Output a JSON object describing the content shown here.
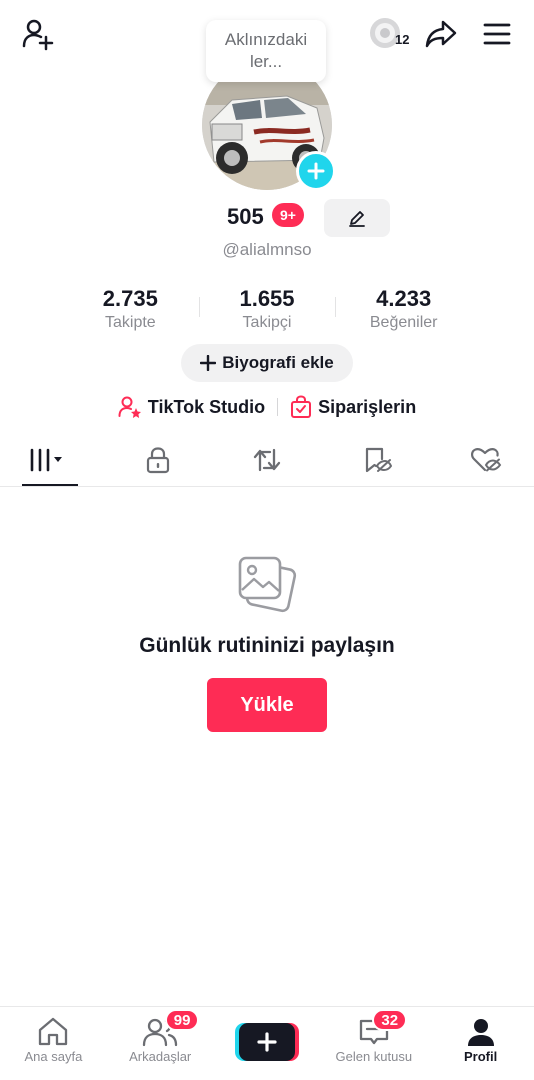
{
  "top_bar": {
    "coin_count": "12"
  },
  "bubble": {
    "text": "Aklınızdaki ler..."
  },
  "profile": {
    "count": "505",
    "badge": "9+",
    "handle": "@alialmnso"
  },
  "stats": [
    {
      "value": "2.735",
      "label": "Takipte"
    },
    {
      "value": "1.655",
      "label": "Takipçi"
    },
    {
      "value": "4.233",
      "label": "Beğeniler"
    }
  ],
  "bio_button": {
    "label": "Biyografi ekle"
  },
  "links": {
    "studio": "TikTok Studio",
    "orders": "Siparişlerin"
  },
  "empty_state": {
    "title": "Günlük rutininizi paylaşın",
    "button": "Yükle"
  },
  "bottom_nav": {
    "items": [
      {
        "label": "Ana sayfa",
        "icon": "home-icon"
      },
      {
        "label": "Arkadaşlar",
        "icon": "friends-icon",
        "badge": "99"
      },
      {
        "label": "",
        "icon": "create-icon"
      },
      {
        "label": "Gelen kutusu",
        "icon": "inbox-icon",
        "badge": "32"
      },
      {
        "label": "Profil",
        "icon": "profile-icon"
      }
    ]
  },
  "colors": {
    "accent": "#fe2c55",
    "cyan": "#20d5ec",
    "text": "#161823",
    "muted": "#8a8b91"
  }
}
